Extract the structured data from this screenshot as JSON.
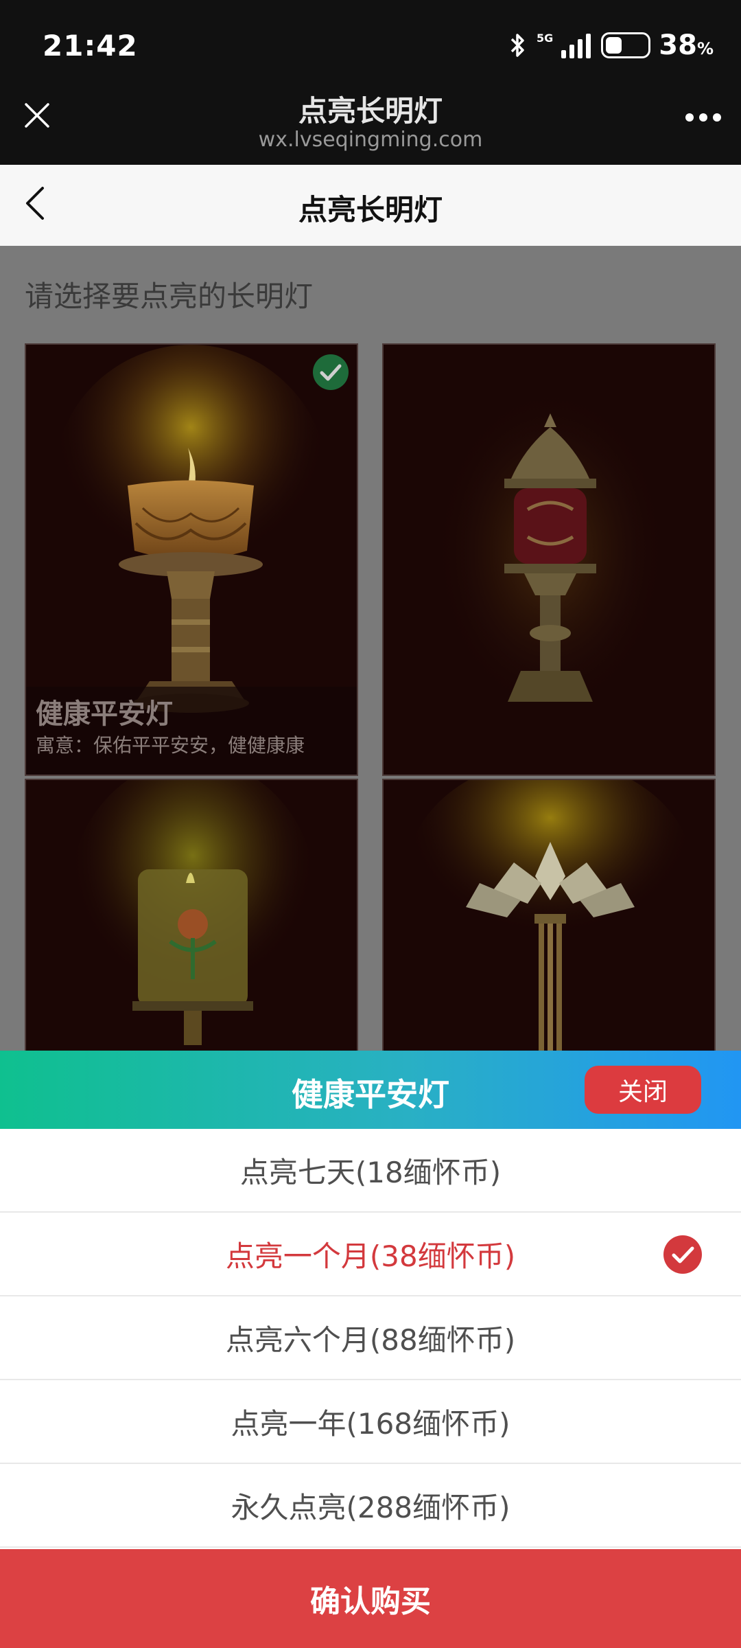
{
  "status_bar": {
    "time": "21:42",
    "network_label": "5G",
    "battery_level": "38",
    "battery_unit": "%",
    "battery_fraction": 0.38
  },
  "web_header": {
    "title": "点亮长明灯",
    "url": "wx.lvseqingming.com",
    "close_icon": "close-icon",
    "more_icon": "more-dots-icon"
  },
  "nav_bar": {
    "title": "点亮长明灯",
    "back_icon": "back-arrow-icon"
  },
  "content": {
    "prompt": "请选择要点亮的长明灯",
    "lamps": [
      {
        "name": "健康平安灯",
        "meaning": "寓意：保佑平平安安，健健康康",
        "selected": true,
        "icon": "lotus-candle-lamp"
      },
      {
        "name": "",
        "meaning": "",
        "selected": false,
        "icon": "brass-pagoda-lamp"
      },
      {
        "name": "",
        "meaning": "",
        "selected": false,
        "icon": "lotus-glass-lantern"
      },
      {
        "name": "",
        "meaning": "",
        "selected": false,
        "icon": "crystal-lotus-lamp"
      }
    ]
  },
  "sheet": {
    "title": "健康平安灯",
    "close_label": "关闭",
    "options": [
      {
        "label": "点亮七天(18缅怀币)",
        "selected": false
      },
      {
        "label": "点亮一个月(38缅怀币)",
        "selected": true
      },
      {
        "label": "点亮六个月(88缅怀币)",
        "selected": false
      },
      {
        "label": "点亮一年(168缅怀币)",
        "selected": false
      },
      {
        "label": "永久点亮(288缅怀币)",
        "selected": false
      }
    ],
    "confirm_label": "确认购买"
  },
  "colors": {
    "accent_red": "#dc4143",
    "selected_text": "#d3393d",
    "header_gradient_start": "#0fc08f",
    "header_gradient_end": "#2196f3",
    "check_green": "#1e8a4a"
  }
}
